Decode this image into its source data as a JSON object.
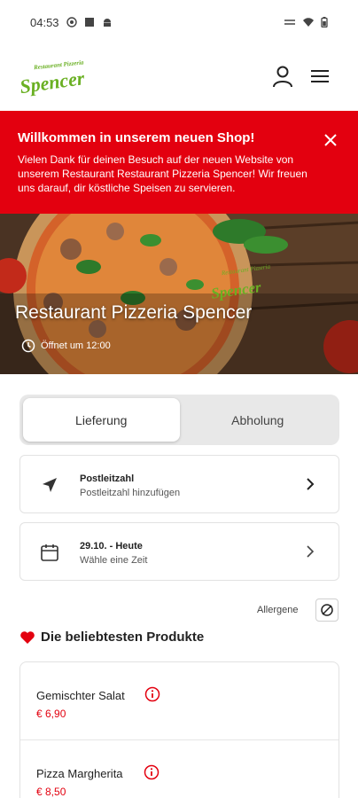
{
  "status_bar": {
    "time": "04:53"
  },
  "header": {
    "logo_top": "Restaurant Pizzeria",
    "logo_main": "Spencer"
  },
  "banner": {
    "title": "Willkommen in unserem neuen Shop!",
    "text": "Vielen Dank für deinen Besuch auf der neuen Website von unserem Restaurant Restaurant Pizzeria Spencer! Wir freuen uns darauf, dir köstliche Speisen zu servieren."
  },
  "hero": {
    "restaurant_name": "Restaurant Pizzeria Spencer",
    "hours": "Öffnet um 12:00",
    "logo_top": "Restaurant Pizzeria",
    "logo_main": "Spencer"
  },
  "order_mode": {
    "options": [
      "Lieferung",
      "Abholung"
    ],
    "selected": "Lieferung"
  },
  "postcode_card": {
    "title": "Postleitzahl",
    "subtitle": "Postleitzahl hinzufügen"
  },
  "time_card": {
    "title": "29.10. - Heute",
    "subtitle": "Wähle eine Zeit"
  },
  "allergens": {
    "label": "Allergene"
  },
  "popular": {
    "title": "Die beliebtesten Produkte",
    "products": [
      {
        "name": "Gemischter Salat",
        "price": "€ 6,90"
      },
      {
        "name": "Pizza Margherita",
        "price": "€ 8,50"
      }
    ]
  },
  "colors": {
    "brand_red": "#e3000f",
    "logo_green": "#6ab023"
  },
  "icons": [
    "user-icon",
    "menu-icon",
    "close-icon",
    "clock-icon",
    "location-arrow-icon",
    "calendar-icon",
    "chevron-right-icon",
    "allergen-icon",
    "heart-icon",
    "info-icon"
  ]
}
